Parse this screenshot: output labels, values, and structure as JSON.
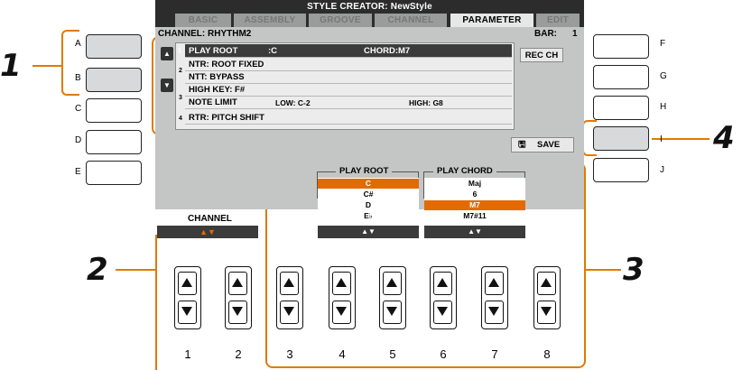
{
  "screen": {
    "title": "STYLE CREATOR: NewStyle",
    "tabs": [
      {
        "label": "BASIC",
        "active": false
      },
      {
        "label": "ASSEMBLY",
        "active": false
      },
      {
        "label": "GROOVE",
        "active": false
      },
      {
        "label": "CHANNEL",
        "active": false
      },
      {
        "label": "PARAMETER",
        "active": true
      },
      {
        "label": "EDIT",
        "active": false
      }
    ],
    "channel_label": "CHANNEL: RHYTHM2",
    "bar_label": "BAR:",
    "bar_value": "1",
    "rows": [
      {
        "num": "1",
        "text": "PLAY ROOT",
        "value": ":C",
        "extra": "CHORD:M7",
        "selected": true
      },
      {
        "num": "2",
        "text": "NTR: ROOT FIXED",
        "selected": false
      },
      {
        "num": "",
        "text": "NTT: BYPASS",
        "selected": false
      },
      {
        "num": "3",
        "text": "HIGH KEY: F#",
        "selected": false
      },
      {
        "num": "",
        "text": "NOTE LIMIT",
        "low": "LOW: C-2",
        "high": "HIGH: G8",
        "selected": false
      },
      {
        "num": "4",
        "text": "RTR: PITCH SHIFT",
        "selected": false
      }
    ],
    "rec_ch_label": "REC CH",
    "save_label": "SAVE",
    "play_root": {
      "header": "PLAY ROOT",
      "options": [
        "C",
        "C#",
        "D",
        "E♭"
      ],
      "selected_index": 0
    },
    "play_chord": {
      "header": "PLAY CHORD",
      "options": [
        "Maj",
        "6",
        "M7",
        "M7#11"
      ],
      "selected_index": 2
    },
    "channel_header": "CHANNEL",
    "arrows_glyph": "▲▼"
  },
  "side_buttons": {
    "left": [
      "A",
      "B",
      "C",
      "D",
      "E"
    ],
    "right": [
      "F",
      "G",
      "H",
      "I",
      "J"
    ]
  },
  "knob_numbers": [
    "1",
    "2",
    "3",
    "4",
    "5",
    "6",
    "7",
    "8"
  ],
  "callouts": [
    "1",
    "2",
    "3",
    "4"
  ],
  "colors": {
    "accent": "#e07a00",
    "selection": "#e36a00",
    "screen": "#c4c6c6"
  }
}
